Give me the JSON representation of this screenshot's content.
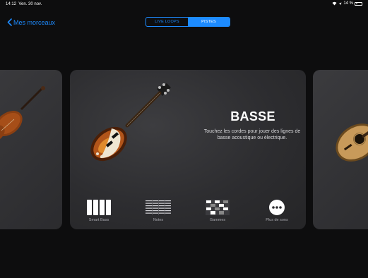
{
  "status_bar": {
    "time": "14:12",
    "date": "Ven. 30 nov.",
    "battery": "14 %"
  },
  "nav": {
    "back_label": "Mes morceaux"
  },
  "segmented": {
    "items": [
      "LIVE LOOPS",
      "PISTES"
    ],
    "selected": "PISTES"
  },
  "instrument": {
    "name": "BASSE",
    "description_line1": "Touchez les cordes pour jouer des lignes de",
    "description_line2": "basse acoustique ou électrique."
  },
  "options": [
    {
      "label": "Smart Bass",
      "icon": "piano-keys-icon"
    },
    {
      "label": "Notes",
      "icon": "notes-grid-icon"
    },
    {
      "label": "Gammes",
      "icon": "scales-grid-icon"
    },
    {
      "label": "Plus de sons",
      "icon": "more-dots-icon"
    }
  ],
  "colors": {
    "accent": "#1d8bff",
    "background": "#0d0d0e",
    "card": "#2f2f32"
  }
}
